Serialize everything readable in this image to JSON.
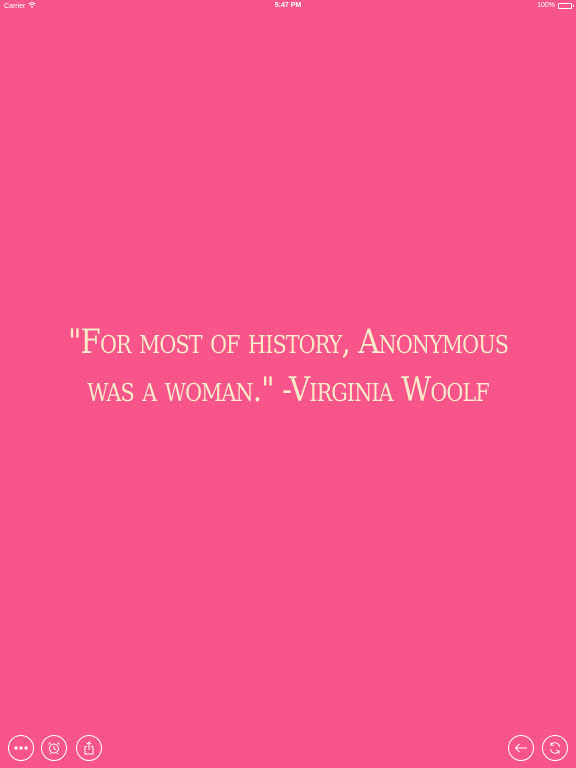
{
  "status_bar": {
    "carrier": "Carrier",
    "time": "5:47 PM",
    "battery": "100%",
    "battery_level": 1.0
  },
  "quote": {
    "text": "\"For most of history, Anonymous was a woman.\" -Virginia Woolf"
  },
  "toolbar": {
    "left_buttons": [
      "more-icon",
      "alarm-clock-icon",
      "share-icon"
    ],
    "right_buttons": [
      "back-arrow-icon",
      "refresh-icon"
    ]
  },
  "colors": {
    "background": "#FA558B",
    "quote_text": "#FCEBC9",
    "icon": "#FFFFFF"
  }
}
